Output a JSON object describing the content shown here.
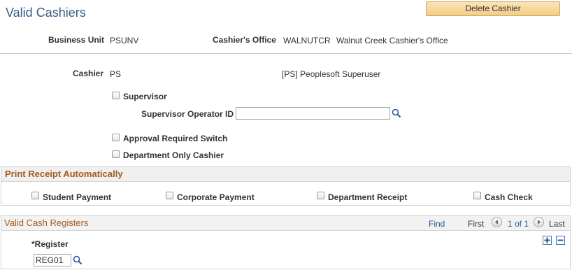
{
  "page": {
    "title": "Valid Cashiers"
  },
  "toolbar": {
    "delete_label": "Delete Cashier"
  },
  "header": {
    "business_unit_label": "Business Unit",
    "business_unit_value": "PSUNV",
    "cashiers_office_label": "Cashier's Office",
    "cashiers_office_code": "WALNUTCR",
    "cashiers_office_desc": "Walnut Creek Cashier's Office"
  },
  "cashier": {
    "label": "Cashier",
    "value": "PS",
    "description": "[PS] Peoplesoft Superuser"
  },
  "options": {
    "supervisor_label": "Supervisor",
    "supervisor_operator_label": "Supervisor Operator ID",
    "supervisor_operator_value": "",
    "approval_label": "Approval Required Switch",
    "department_only_label": "Department Only Cashier"
  },
  "print_receipt": {
    "title": "Print Receipt Automatically",
    "student_payment": "Student Payment",
    "corporate_payment": "Corporate Payment",
    "department_receipt": "Department Receipt",
    "cash_check": "Cash Check"
  },
  "registers": {
    "title": "Valid Cash Registers",
    "find": "Find",
    "first": "First",
    "range": "1 of 1",
    "last": "Last",
    "register_label": "*Register",
    "register_value": "REG01"
  },
  "colors": {
    "title": "#3b5b87",
    "section_header": "#a45b1e",
    "link": "#2457a0",
    "button_fill": "#f3cd86"
  },
  "icons": {
    "lookup": "magnifier-icon",
    "prev": "chevron-left-icon",
    "next": "chevron-right-icon",
    "add_row": "plus-icon",
    "delete_row": "minus-icon"
  }
}
